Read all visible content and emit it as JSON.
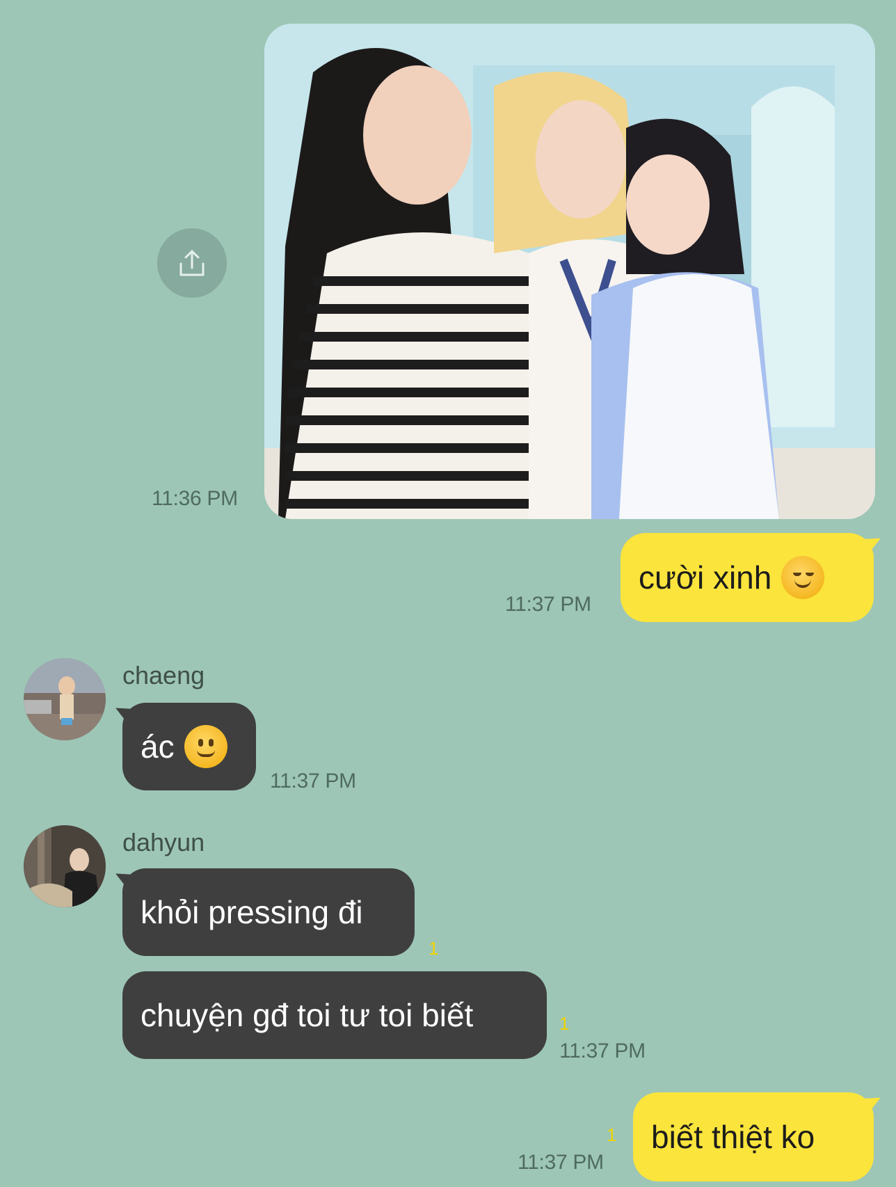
{
  "messages": {
    "photo_time": "11:36 PM",
    "m1": {
      "text": "cười xinh",
      "emoji": "smiling-blush-emoji",
      "time": "11:37 PM"
    },
    "m2": {
      "sender": "chaeng",
      "text": "ác",
      "emoji": "slight-smile-emoji",
      "time": "11:37 PM"
    },
    "m3": {
      "sender": "dahyun",
      "lines": [
        "khỏi pressing đi",
        "chuyện gđ toi tư toi biết"
      ],
      "unread": [
        "1",
        "1"
      ],
      "time": "11:37 PM"
    },
    "m4": {
      "text": "biết thiệt ko",
      "unread": "1",
      "time": "11:37 PM"
    }
  },
  "colors": {
    "background": "#9dc6b6",
    "my_bubble": "#fbe43c",
    "their_bubble": "#3f3f3f",
    "unread": "#f2d300"
  },
  "icons": {
    "share": "share-icon"
  }
}
